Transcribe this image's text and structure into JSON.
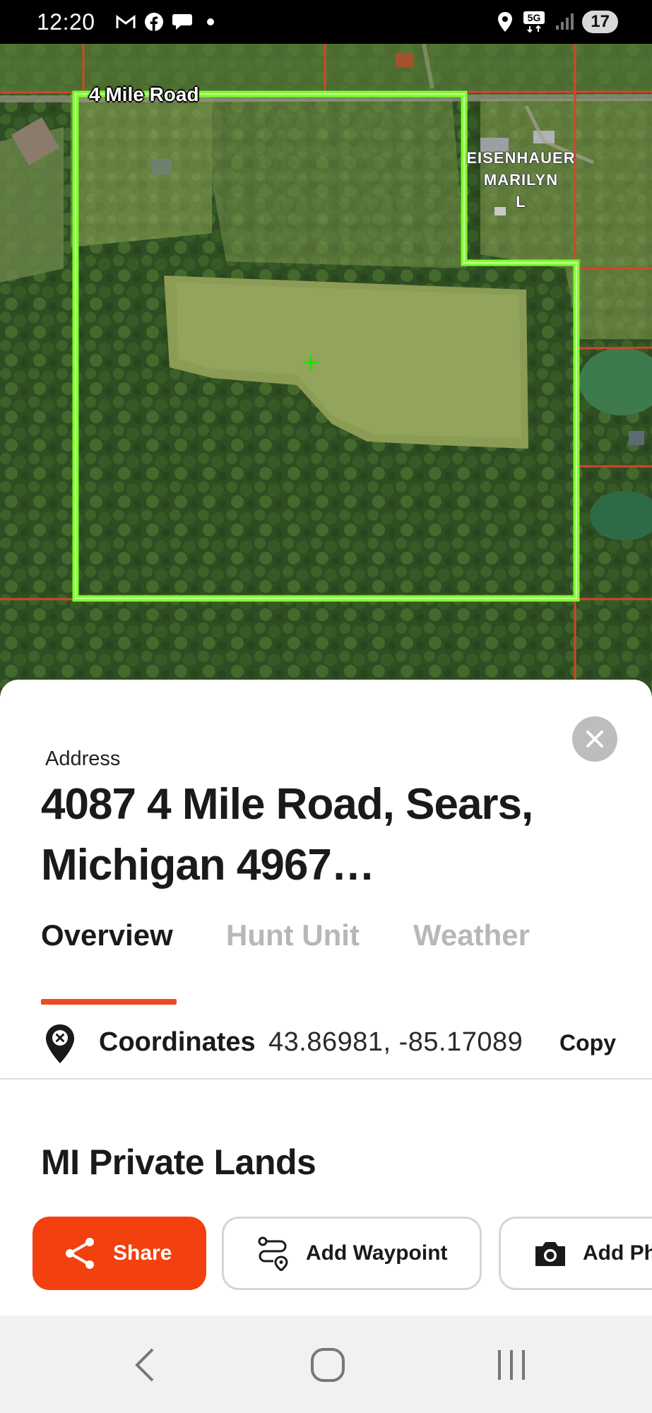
{
  "status_bar": {
    "time": "12:20",
    "notification_icons": [
      "gmail-icon",
      "facebook-icon",
      "chat-icon",
      "dot-icon"
    ],
    "system_icons": [
      "location-icon",
      "5g-icon",
      "signal-icon"
    ],
    "network": "5G",
    "battery": "17"
  },
  "map": {
    "road_label": "4 Mile Road",
    "owner_label": [
      "EISENHAUER",
      "MARILYN",
      "L"
    ],
    "colors": {
      "parcel_outline": "#7dff2e",
      "lot_lines": "#d2462a",
      "crosshair": "#22e000"
    }
  },
  "sheet": {
    "address_label": "Address",
    "address_title": "4087 4 Mile Road, Sears, Michigan 4967…",
    "tabs": [
      {
        "label": "Overview",
        "active": true
      },
      {
        "label": "Hunt Unit",
        "active": false
      },
      {
        "label": "Weather",
        "active": false
      }
    ],
    "coordinates": {
      "label": "Coordinates",
      "value": "43.86981, -85.17089",
      "copy_label": "Copy"
    },
    "section_title": "MI Private Lands",
    "actions": {
      "share": "Share",
      "add_waypoint": "Add Waypoint",
      "add_photo": "Add Ph"
    }
  },
  "colors": {
    "accent": "#f2400f",
    "inactive_tab": "#b7b7b7"
  }
}
